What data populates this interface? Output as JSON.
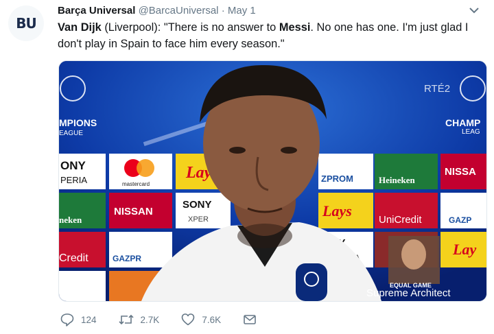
{
  "tweet": {
    "avatar_text": "BU",
    "author_name": "Barça Universal",
    "author_handle": "@BarcaUniversal",
    "separator": "·",
    "date": "May 1",
    "text_part1_bold": "Van Dijk",
    "text_part2": " (Liverpool): \"There is no answer to ",
    "text_part3_bold": "Messi",
    "text_part4": ". No one has one. I'm just glad I don't play in Spain to face him every season.\""
  },
  "media": {
    "overlay_channel": "RTÉ2",
    "board_text_left": "MPIONS",
    "board_text_left2": "EAGUE",
    "board_text_right": "CHAMP",
    "board_text_right2": "LEAG",
    "sponsors": [
      "ONY",
      "PERIA",
      "mastercard",
      "Lay",
      "ZPROM",
      "Heineken",
      "NISSA",
      "neken",
      "NISSAN",
      "SONY",
      "XPER",
      "Lays",
      "UniCredit",
      "GAZP",
      "Credit",
      "GAZPR",
      "SONY",
      "RIA",
      "Lay"
    ],
    "watermark_top": "EQUAL GAME",
    "watermark": "Supreme Architect"
  },
  "actions": {
    "replies": "124",
    "retweets": "2.7K",
    "likes": "7.6K"
  },
  "colors": {
    "link_blue": "#1da1f2",
    "muted": "#657786",
    "board_blue": "#0b2a8a"
  }
}
